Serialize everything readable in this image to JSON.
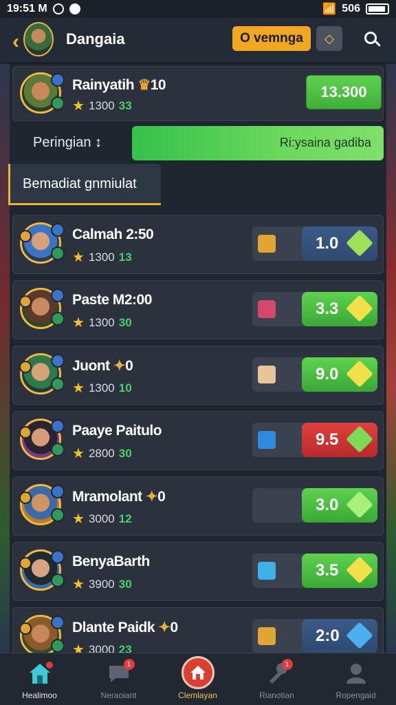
{
  "status_bar": {
    "time": "19:51 M",
    "battery": "506"
  },
  "header": {
    "title": "Dangaia",
    "pill_label": "O vemnga",
    "gem_button_icon": "diamond-icon",
    "search_icon": "search-icon"
  },
  "top_card": {
    "name": "Rainyatih",
    "name_suffix": "10",
    "points": "1300",
    "level": "33",
    "button_label": "13.300"
  },
  "progress_row": {
    "label": "Peringian",
    "label_icon": "↕",
    "progress_text": "Ri:ysaina gadiba",
    "progress_fraction": 1.0
  },
  "section_tab": {
    "label": "Bemadiat gnmiulat"
  },
  "rows": [
    {
      "name": "Calmah 2:50",
      "points": "1300",
      "level": "13",
      "value": "1.0",
      "item_color": "#e0a532",
      "value_style": "blue",
      "gem_color": "#9ee05a"
    },
    {
      "name": "Paste M2:00",
      "points": "1300",
      "level": "30",
      "value": "3.3",
      "item_color": "#d6486a",
      "value_style": "green",
      "gem_color": "#f2e04a"
    },
    {
      "name": "Juont",
      "name_suffix": "0",
      "points": "1300",
      "level": "10",
      "value": "9.0",
      "item_color": "#e8c49a",
      "value_style": "green",
      "gem_color": "#f2e04a"
    },
    {
      "name": "Paaye Paitulo",
      "points": "2800",
      "level": "30",
      "value": "9.5",
      "item_color": "#2f8ae0",
      "value_style": "red",
      "gem_color": "#7ed957"
    },
    {
      "name": "Mramolant",
      "name_suffix": "0",
      "points": "3000",
      "level": "12",
      "value": "3.0",
      "item_color": "#3a424f",
      "value_style": "green",
      "gem_color": "#a8f07a"
    },
    {
      "name": "BenyaBarth",
      "points": "3900",
      "level": "30",
      "value": "3.5",
      "item_color": "#3fb0e6",
      "value_style": "green",
      "gem_color": "#f2e04a"
    },
    {
      "name": "Dlante Paidk",
      "name_suffix": "0",
      "points": "3000",
      "level": "23",
      "value": "2:0",
      "item_color": "#e0a532",
      "value_style": "blue",
      "gem_color": "#4ab0ef"
    }
  ],
  "nav": [
    {
      "label": "Healimoo",
      "icon": "home-icon",
      "active": true
    },
    {
      "label": "Neraoiant",
      "icon": "chat-icon",
      "badge": "1"
    },
    {
      "label": "Clemlayan",
      "icon": "house-icon",
      "highlight": true
    },
    {
      "label": "Rianotian",
      "icon": "wrench-icon",
      "badge": "1"
    },
    {
      "label": "Ropengaid",
      "icon": "profile-icon"
    }
  ]
}
